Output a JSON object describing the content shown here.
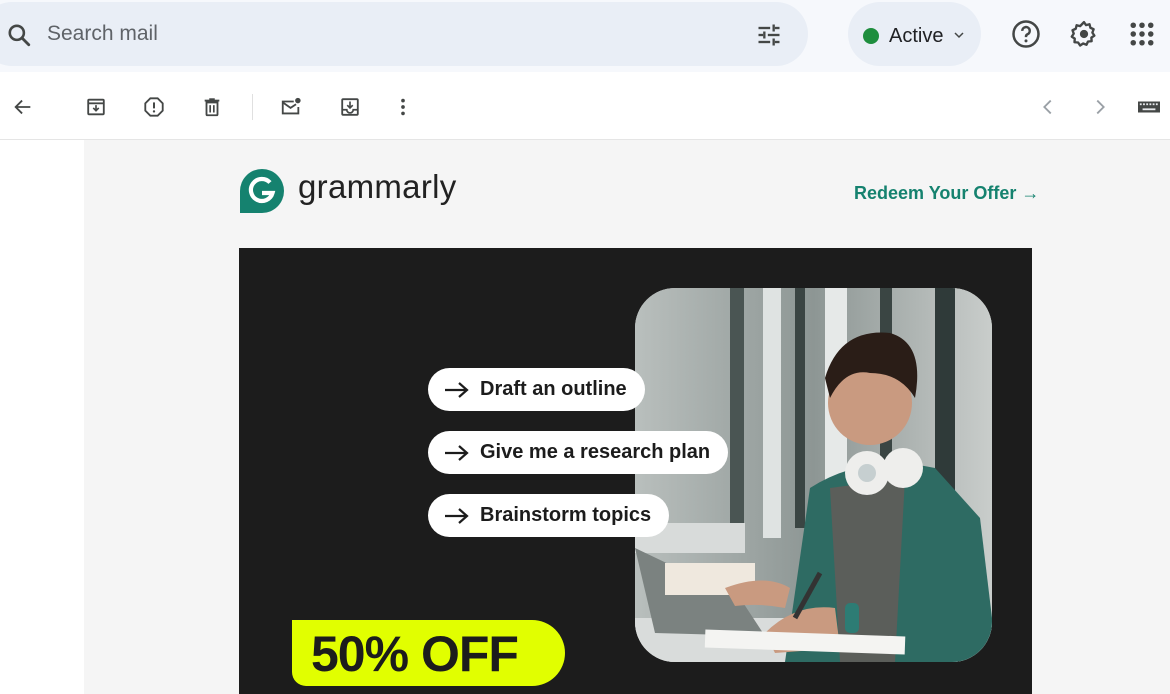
{
  "header": {
    "search_placeholder": "Search mail",
    "status_label": "Active",
    "status_color": "#1e8e3e",
    "icons": [
      "search-icon",
      "tune-icon",
      "help-icon",
      "settings-icon",
      "apps-icon"
    ]
  },
  "toolbar": {
    "icons": [
      "back-arrow-icon",
      "archive-icon",
      "report-spam-icon",
      "delete-icon",
      "mark-unread-icon",
      "move-to-icon",
      "more-vert-icon",
      "prev-icon",
      "next-icon",
      "keyboard-icon"
    ]
  },
  "email": {
    "brand_name": "grammarly",
    "brand_color": "#15826f",
    "redeem_link": "Redeem Your Offer →",
    "prompts": [
      "Draft an outline",
      "Give me a research plan",
      "Brainstorm topics"
    ],
    "offer": "50% OFF",
    "offer_color": "#e1ff00",
    "banner_bg": "#1c1c1c"
  }
}
